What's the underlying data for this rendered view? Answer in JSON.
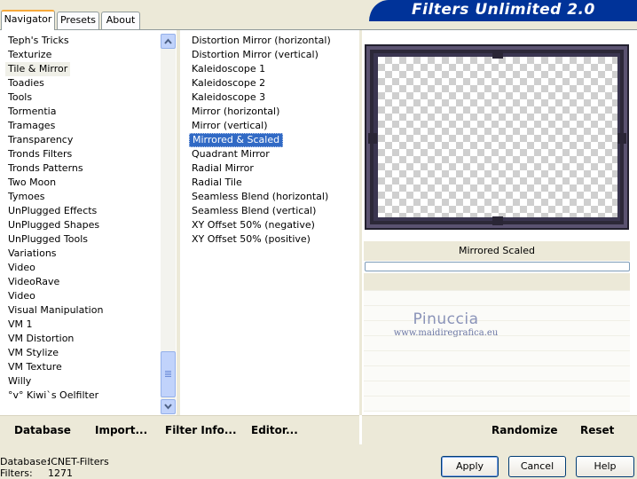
{
  "tabs": [
    {
      "label": "Navigator"
    },
    {
      "label": "Presets"
    },
    {
      "label": "About"
    }
  ],
  "banner": {
    "title": "Filters Unlimited 2.0"
  },
  "category_list": {
    "items": [
      "Teph's Tricks",
      "Texturize",
      "Tile & Mirror",
      "Toadies",
      "Tools",
      "Tormentia",
      "Tramages",
      "Transparency",
      "Tronds Filters",
      "Tronds Patterns",
      "Two Moon",
      "Tymoes",
      "UnPlugged Effects",
      "UnPlugged Shapes",
      "UnPlugged Tools",
      "Variations",
      "Video",
      "VideoRave",
      "Video",
      "Visual Manipulation",
      "VM 1",
      "VM Distortion",
      "VM Stylize",
      "VM Texture",
      "Willy",
      "°v° Kiwi`s Oelfilter"
    ],
    "selected": "Tile & Mirror"
  },
  "filter_list": {
    "items": [
      "Distortion Mirror (horizontal)",
      "Distortion Mirror (vertical)",
      "Kaleidoscope 1",
      "Kaleidoscope 2",
      "Kaleidoscope 3",
      "Mirror (horizontal)",
      "Mirror (vertical)",
      "Mirrored & Scaled",
      "Quadrant Mirror",
      "Radial Mirror",
      "Radial Tile",
      "Seamless Blend (horizontal)",
      "Seamless Blend (vertical)",
      "XY Offset 50% (negative)",
      "XY Offset 50% (positive)"
    ],
    "selected": "Mirrored & Scaled"
  },
  "preview": {
    "filter_title": "Mirrored  Scaled"
  },
  "watermark": {
    "name": "Pinuccia",
    "url": "www.maidiregrafica.eu"
  },
  "toolbar": {
    "database": "Database",
    "import": "Import...",
    "filter_info": "Filter Info...",
    "editor": "Editor...",
    "randomize": "Randomize",
    "reset": "Reset"
  },
  "status": {
    "database_label": "Database:",
    "database_value": "ICNET-Filters",
    "filters_label": "Filters:",
    "filters_value": "1271"
  },
  "buttons": {
    "apply": "Apply",
    "cancel": "Cancel",
    "help": "Help"
  },
  "colors": {
    "banner": "#003399",
    "selection": "#316ac5",
    "tab_accent": "#f7a93b"
  }
}
